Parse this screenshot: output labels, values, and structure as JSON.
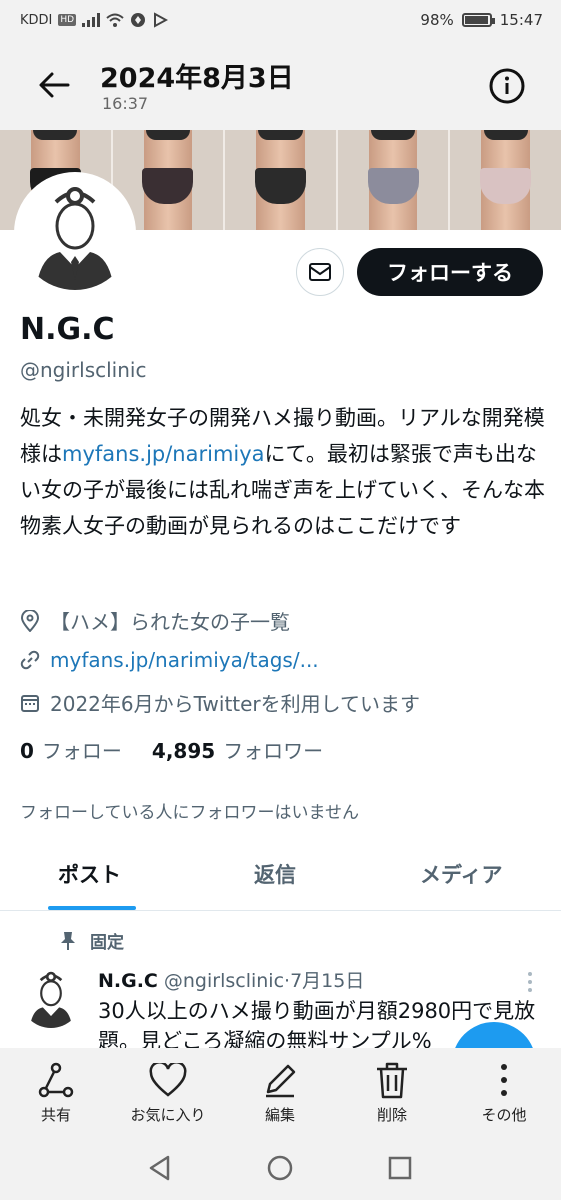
{
  "status_bar": {
    "carrier": "KDDI",
    "hd": "HD",
    "battery_percent": 98,
    "battery_label": "98%",
    "time": "15:47"
  },
  "nav": {
    "title": "2024年8月3日",
    "subtitle": "16:37",
    "back_icon": "arrow-left-icon",
    "info_icon": "info-icon"
  },
  "banner": {
    "panels": [
      {
        "pant_color": "#1c1c1c"
      },
      {
        "pant_color": "#3a2f33"
      },
      {
        "pant_color": "#2b2b2b"
      },
      {
        "pant_color": "#8c8c9c"
      },
      {
        "pant_color": "#d9c2c2"
      }
    ]
  },
  "profile": {
    "display_name": "N.G.C",
    "handle": "@ngirlsclinic",
    "follow_label": "フォローする",
    "message_icon": "mail-icon",
    "bio_part1": "処女・未開発女子の開発ハメ撮り動画。リアルな開発模様は",
    "bio_link": "myfans.jp/narimiya",
    "bio_part2": "にて。最初は緊張で声も出ない女の子が最後には乱れ喘ぎ声を上げていく、そんな本物素人女子の動画が見られるのはここだけです",
    "location": "【ハメ】られた女の子一覧",
    "website": "myfans.jp/narimiya/tags/...",
    "joined": "2022年6月からTwitterを利用しています",
    "following_count": "0",
    "following_label": "フォロー",
    "followers_count": "4,895",
    "followers_label": "フォロワー",
    "mutual_note": "フォローしている人にフォロワーはいません"
  },
  "tabs": [
    {
      "label": "ポスト",
      "active": true
    },
    {
      "label": "返信",
      "active": false
    },
    {
      "label": "メディア",
      "active": false
    }
  ],
  "post": {
    "pinned_label": "固定",
    "name": "N.G.C",
    "handle": "@ngirlsclinic",
    "date": "7月15日",
    "separator": "·",
    "text": "30人以上のハメ撮り動画が月額2980円で見放題。見どころ凝縮の無料サンプル%"
  },
  "actions": [
    {
      "label": "共有",
      "icon": "share-icon"
    },
    {
      "label": "お気に入り",
      "icon": "heart-icon"
    },
    {
      "label": "編集",
      "icon": "pencil-icon"
    },
    {
      "label": "削除",
      "icon": "trash-icon"
    },
    {
      "label": "その他",
      "icon": "more-vertical-icon"
    }
  ],
  "accent_color": "#1d9bf0",
  "link_color": "#1d77b8"
}
